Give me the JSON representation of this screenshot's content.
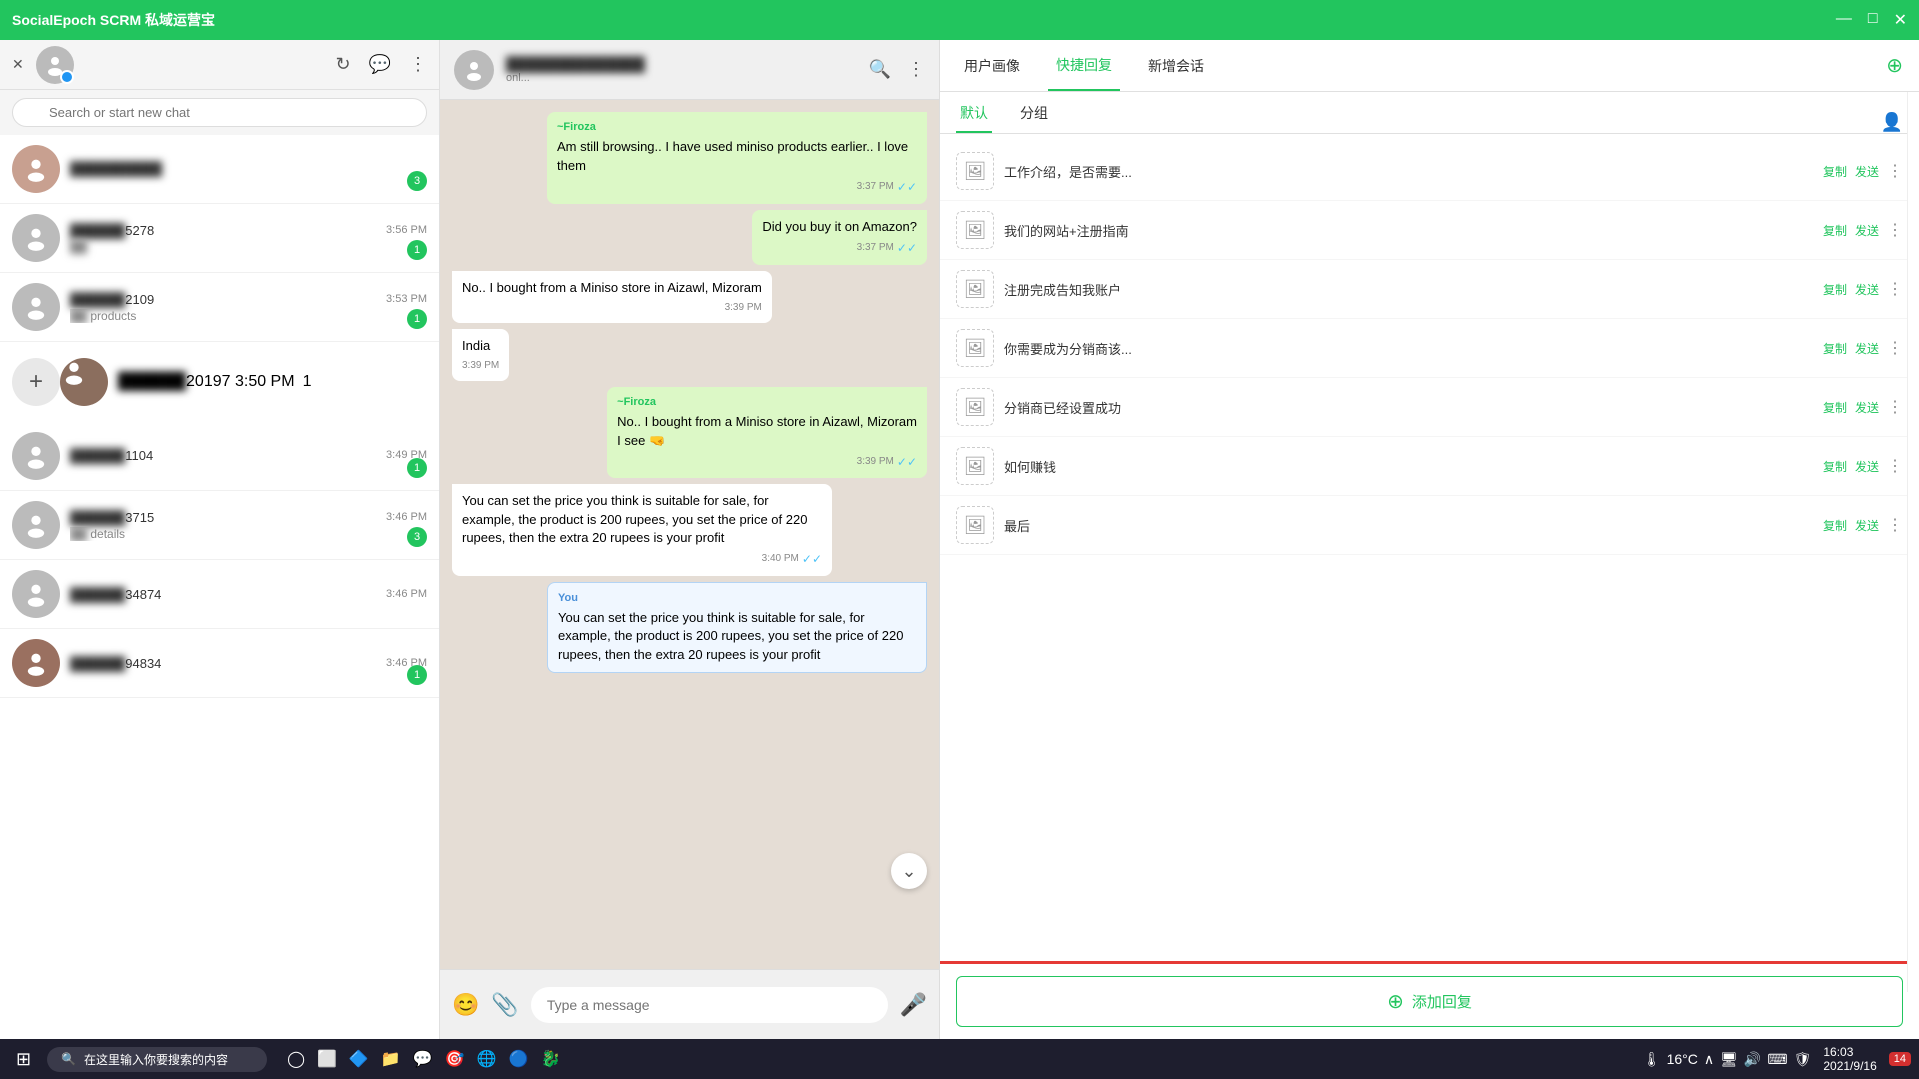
{
  "titlebar": {
    "title": "SocialEpoch SCRM 私域运营宝",
    "minimize": "—",
    "maximize": "□",
    "close": "✕"
  },
  "sidebar": {
    "close_icon": "✕",
    "search_placeholder": "Search or start new chat",
    "add_button": "+",
    "chats": [
      {
        "id": 1,
        "name": "██████",
        "preview": "",
        "time": "",
        "badge": "3",
        "has_photo": true
      },
      {
        "id": 2,
        "name": "██████5278",
        "preview": "██",
        "time": "3:56 PM",
        "badge": "1",
        "has_photo": false
      },
      {
        "id": 3,
        "name": "██████2109",
        "preview": "██ products",
        "time": "3:53 PM",
        "badge": "1",
        "has_photo": false
      },
      {
        "id": 4,
        "name": "██████20197",
        "preview": "",
        "time": "3:50 PM",
        "badge": "1",
        "has_photo": true
      },
      {
        "id": 5,
        "name": "██████1104",
        "preview": "",
        "time": "3:49 PM",
        "badge": "1",
        "has_photo": false
      },
      {
        "id": 6,
        "name": "██████3715",
        "preview": "██ details",
        "time": "3:46 PM",
        "badge": "3",
        "has_photo": false
      },
      {
        "id": 7,
        "name": "██████34874",
        "preview": "",
        "time": "3:46 PM",
        "badge": "",
        "has_photo": false
      },
      {
        "id": 8,
        "name": "██████94834",
        "preview": "",
        "time": "3:46 PM",
        "badge": "1",
        "has_photo": true
      }
    ]
  },
  "chat_header": {
    "contact_name": "██████████",
    "contact_status": "onl..."
  },
  "messages": [
    {
      "id": 1,
      "type": "out",
      "sender": "~Firoza",
      "text": "Am still browsing.. I have used miniso products earlier.. I love them",
      "time": "3:37 PM",
      "tick": "✓✓"
    },
    {
      "id": 2,
      "type": "out",
      "text": "Did you buy it on Amazon?",
      "time": "3:37 PM",
      "tick": "✓✓"
    },
    {
      "id": 3,
      "type": "in",
      "text": "No.. I bought from a Miniso store in Aizawl, Mizoram",
      "time": "3:39 PM"
    },
    {
      "id": 4,
      "type": "in",
      "text": "India",
      "time": "3:39 PM"
    },
    {
      "id": 5,
      "type": "out",
      "sender": "~Firoza",
      "text": "No.. I bought from a Miniso store in Aizawl, Mizoram",
      "subtext": "I see 🤜",
      "time": "3:39 PM",
      "tick": "✓✓"
    },
    {
      "id": 6,
      "type": "in",
      "text": "You can set the price you think is suitable for sale, for example, the product is 200 rupees, you set the price of 220 rupees, then the extra 20 rupees is your profit",
      "time": "3:40 PM",
      "tick": "✓✓"
    },
    {
      "id": 7,
      "type": "you",
      "you_label": "You",
      "text": "You can set the price you think is suitable for sale, for example, the product is 200 rupees, you set the price of 220 rupees, then the extra 20 rupees is your profit",
      "time": ""
    }
  ],
  "input": {
    "placeholder": "Type a message"
  },
  "right_panel": {
    "tabs": [
      {
        "id": "portrait",
        "label": "用户画像"
      },
      {
        "id": "quickreply",
        "label": "快捷回复"
      },
      {
        "id": "newchat",
        "label": "新增会话"
      }
    ],
    "active_tab": "quickreply",
    "sub_tabs": [
      {
        "id": "default",
        "label": "默认"
      },
      {
        "id": "group",
        "label": "分组"
      }
    ],
    "active_sub_tab": "default",
    "quick_replies": [
      {
        "id": 1,
        "text": "工作介绍，是否需要..."
      },
      {
        "id": 2,
        "text": "我们的网站+注册指南"
      },
      {
        "id": 3,
        "text": "注册完成告知我账户"
      },
      {
        "id": 4,
        "text": "你需要成为分销商该..."
      },
      {
        "id": 5,
        "text": "分销商已经设置成功"
      },
      {
        "id": 6,
        "text": "如何赚钱"
      },
      {
        "id": 7,
        "text": "最后"
      }
    ],
    "action_copy": "复制",
    "action_send": "发送",
    "add_reply_label": "添加回复"
  },
  "taskbar": {
    "start_icon": "⊞",
    "search_text": "在这里输入你要搜索的内容",
    "icons": [
      "◯",
      "⬜",
      "🔷",
      "📁",
      "🐾",
      "🎯",
      "🌐",
      "🔵",
      "🐉"
    ],
    "weather": "16°C",
    "time": "16:03",
    "date": "2021/9/16",
    "notification_count": "14"
  }
}
